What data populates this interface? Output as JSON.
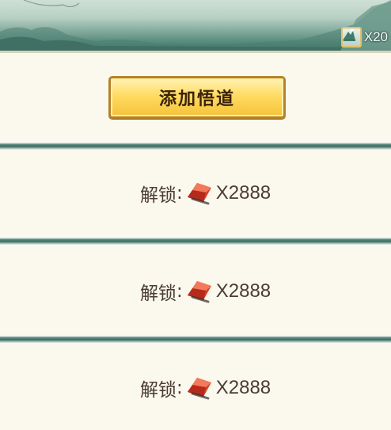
{
  "header": {
    "reward_icon": "scroll-icon",
    "reward_quantity": "X20"
  },
  "add_button": {
    "label": "添加悟道"
  },
  "slots": [
    {
      "label": "解锁",
      "colon": ":",
      "currency_icon": "red-gem-icon",
      "cost": "X2888"
    },
    {
      "label": "解锁",
      "colon": ":",
      "currency_icon": "red-gem-icon",
      "cost": "X2888"
    },
    {
      "label": "解锁",
      "colon": ":",
      "currency_icon": "red-gem-icon",
      "cost": "X2888"
    }
  ]
}
